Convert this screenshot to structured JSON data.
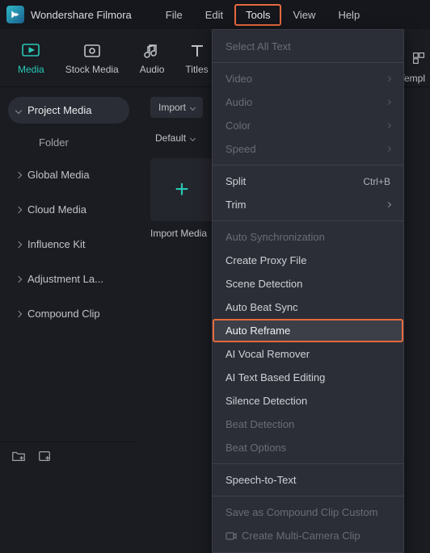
{
  "app": {
    "title": "Wondershare Filmora"
  },
  "menubar": {
    "file": "File",
    "edit": "Edit",
    "tools": "Tools",
    "view": "View",
    "help": "Help"
  },
  "tabs": {
    "media": "Media",
    "stock_media": "Stock Media",
    "audio": "Audio",
    "titles": "Titles",
    "templ": "Templ"
  },
  "sidebar": {
    "project_media": "Project Media",
    "folder": "Folder",
    "global_media": "Global Media",
    "cloud_media": "Cloud Media",
    "influence_kit": "Influence Kit",
    "adjustment_la": "Adjustment La...",
    "compound_clip": "Compound Clip"
  },
  "content": {
    "import_btn": "Import",
    "default_btn": "Default",
    "import_media_label": "Import Media"
  },
  "tools_menu": {
    "select_all_text": "Select All Text",
    "video": "Video",
    "audio": "Audio",
    "color": "Color",
    "speed": "Speed",
    "split": "Split",
    "split_shortcut": "Ctrl+B",
    "trim": "Trim",
    "auto_sync": "Auto Synchronization",
    "create_proxy": "Create Proxy File",
    "scene_detection": "Scene Detection",
    "auto_beat_sync": "Auto Beat Sync",
    "auto_reframe": "Auto Reframe",
    "ai_vocal_remover": "AI Vocal Remover",
    "ai_text_editing": "AI Text Based Editing",
    "silence_detection": "Silence Detection",
    "beat_detection": "Beat Detection",
    "beat_options": "Beat Options",
    "speech_to_text": "Speech-to-Text",
    "save_compound": "Save as Compound Clip Custom",
    "create_multicam": "Create Multi-Camera Clip"
  }
}
